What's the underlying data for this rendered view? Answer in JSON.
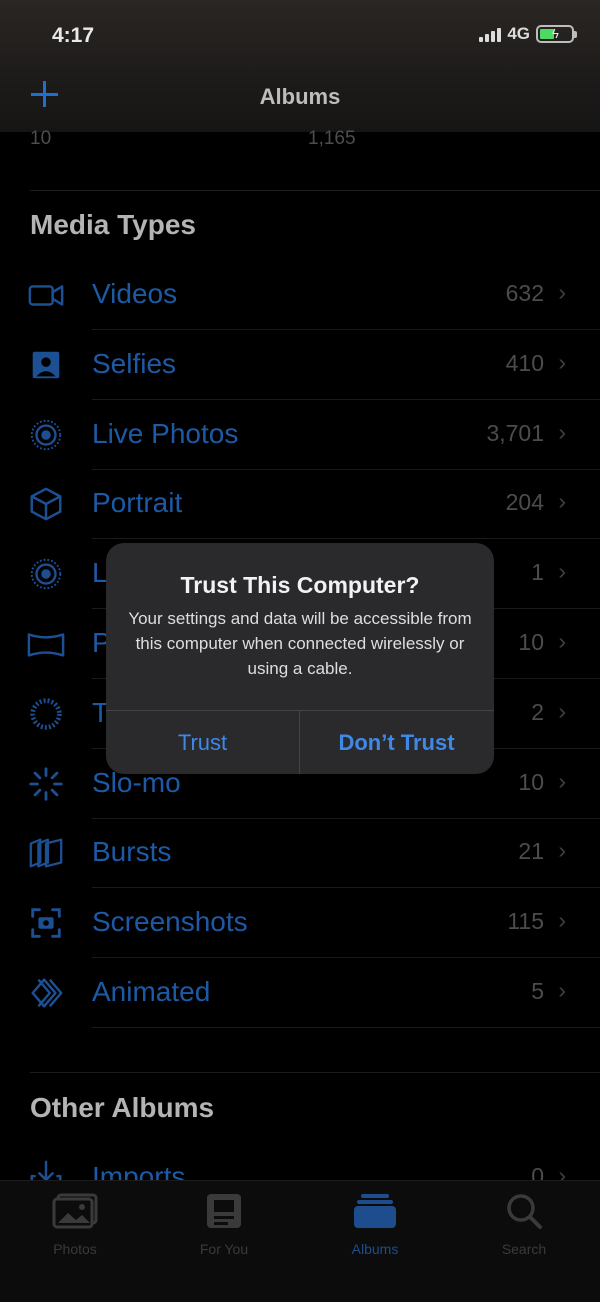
{
  "status_bar": {
    "time": "4:17",
    "network": "4G"
  },
  "nav": {
    "title": "Albums"
  },
  "top_counts": [
    "10",
    "1,165"
  ],
  "media_types": {
    "header": "Media Types",
    "items": [
      {
        "icon": "video-icon",
        "label": "Videos",
        "count": "632"
      },
      {
        "icon": "selfie-icon",
        "label": "Selfies",
        "count": "410"
      },
      {
        "icon": "live-photo-icon",
        "label": "Live Photos",
        "count": "3,701"
      },
      {
        "icon": "portrait-cube-icon",
        "label": "Portrait",
        "count": "204"
      },
      {
        "icon": "live-photo-icon",
        "label": "L",
        "count": "1"
      },
      {
        "icon": "panorama-icon",
        "label": "P",
        "count": "10"
      },
      {
        "icon": "time-lapse-icon",
        "label": "T",
        "count": "2"
      },
      {
        "icon": "slo-mo-icon",
        "label": "Slo-mo",
        "count": "10"
      },
      {
        "icon": "bursts-icon",
        "label": "Bursts",
        "count": "21"
      },
      {
        "icon": "screenshot-icon",
        "label": "Screenshots",
        "count": "115"
      },
      {
        "icon": "animated-icon",
        "label": "Animated",
        "count": "5"
      }
    ]
  },
  "other_albums": {
    "header": "Other Albums",
    "items": [
      {
        "icon": "import-icon",
        "label": "Imports",
        "count": "0"
      }
    ]
  },
  "dialog": {
    "title": "Trust This Computer?",
    "message": "Your settings and data will be accessible from this computer when connected wirelessly or using a cable.",
    "trust_label": "Trust",
    "dont_trust_label": "Don’t Trust"
  },
  "tabbar": {
    "tabs": [
      {
        "label": "Photos",
        "icon": "photos-icon"
      },
      {
        "label": "For You",
        "icon": "for-you-icon"
      },
      {
        "label": "Albums",
        "icon": "albums-icon",
        "active": true
      },
      {
        "label": "Search",
        "icon": "search-icon"
      }
    ]
  },
  "colors": {
    "accent": "#1d5aa6",
    "dialog_button": "#3e88e6",
    "battery": "#4cd964"
  }
}
